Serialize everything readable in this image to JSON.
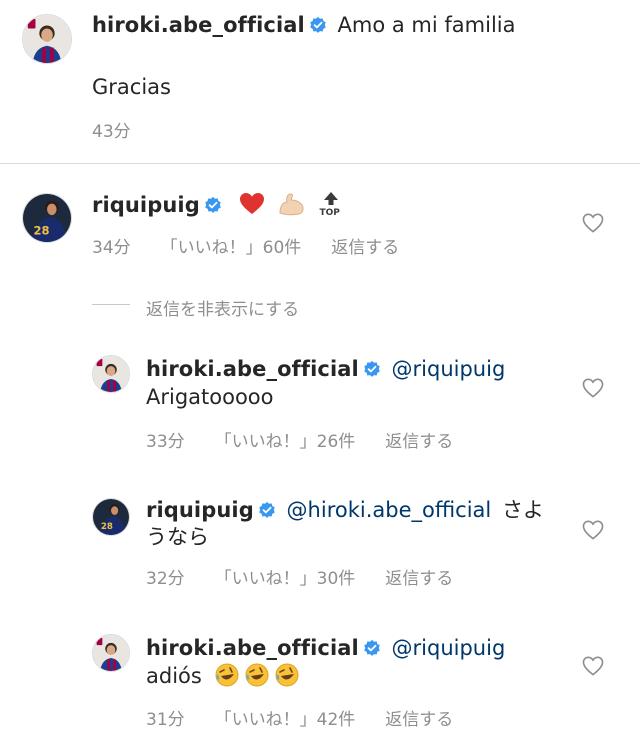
{
  "caption": {
    "username": "hiroki.abe_official",
    "text": "Amo a mi familia",
    "text2": "Gracias",
    "time": "43分"
  },
  "comment": {
    "username": "riquipuig",
    "emoji": [
      "red-heart-icon",
      "flexed-biceps-icon",
      "top-arrow-icon"
    ],
    "top_label": "TOP",
    "time": "34分",
    "likes": "「いいね！」60件",
    "reply_label": "返信する",
    "hide_replies": "返信を非表示にする"
  },
  "replies": [
    {
      "username": "hiroki.abe_official",
      "mention": "@riquipuig",
      "text": "Arigatooooo",
      "time": "33分",
      "likes": "「いいね！」26件",
      "reply_label": "返信する"
    },
    {
      "username": "riquipuig",
      "mention": "@hiroki.abe_official",
      "text_inline": "さよ",
      "text": "うなら",
      "time": "32分",
      "likes": "「いいね！」30件",
      "reply_label": "返信する"
    },
    {
      "username": "hiroki.abe_official",
      "mention": "@riquipuig",
      "text": "adiós",
      "emoji": [
        "rolling-laughing-icon",
        "rolling-laughing-icon",
        "rolling-laughing-icon"
      ],
      "time": "31分",
      "likes": "「いいね！」42件",
      "reply_label": "返信する"
    }
  ],
  "colors": {
    "verified": "#3897f0",
    "mention": "#00376b",
    "meta": "#8e8e8e",
    "divider": "#dbdbdb"
  }
}
